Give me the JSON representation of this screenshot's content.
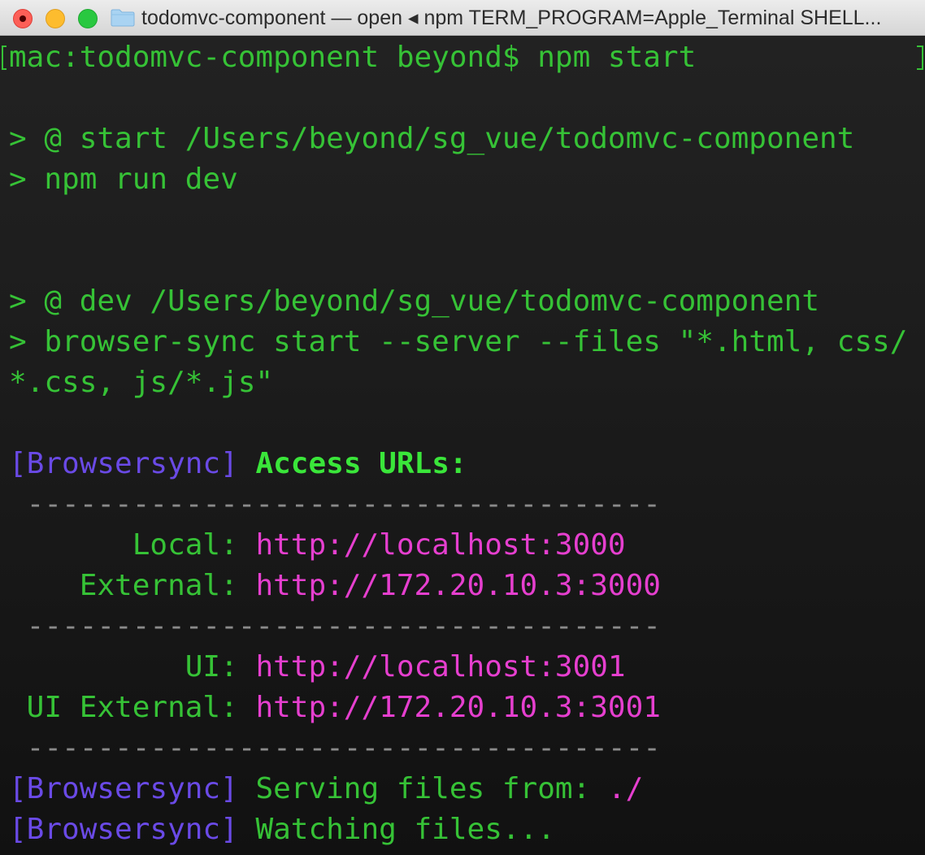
{
  "window": {
    "title": "todomvc-component — open ◂ npm TERM_PROGRAM=Apple_Terminal SHELL..."
  },
  "icons": {
    "close": "close-icon",
    "minimize": "minimize-icon",
    "zoom": "zoom-icon",
    "folder": "folder-icon"
  },
  "colors": {
    "terminal_bg": "#1c1c1c",
    "green": "#36c236",
    "bright_green": "#3ae63a",
    "blue": "#6a4ae6",
    "magenta": "#e63fcf"
  },
  "terminal": {
    "prompt": "mac:todomvc-component beyond$ npm start",
    "script_start": "> @ start /Users/beyond/sg_vue/todomvc-component",
    "npm_run_dev": "> npm run dev",
    "script_dev": "> @ dev /Users/beyond/sg_vue/todomvc-component",
    "browser_sync_cmd_1": "> browser-sync start --server --files \"*.html, css/",
    "browser_sync_cmd_2": "*.css, js/*.js\"",
    "bs_tag": "[Browsersync]",
    "access_urls": "Access URLs:",
    "separator": " ------------------------------------",
    "local_label": "       Local: ",
    "local_url": "http://localhost:3000",
    "external_label": "    External: ",
    "external_url": "http://172.20.10.3:3000",
    "ui_label": "          UI: ",
    "ui_url": "http://localhost:3001",
    "ui_external_label": " UI External: ",
    "ui_external_url": "http://172.20.10.3:3001",
    "serving_text": " Serving files from: ",
    "serving_path": "./",
    "watching_text": " Watching files..."
  }
}
